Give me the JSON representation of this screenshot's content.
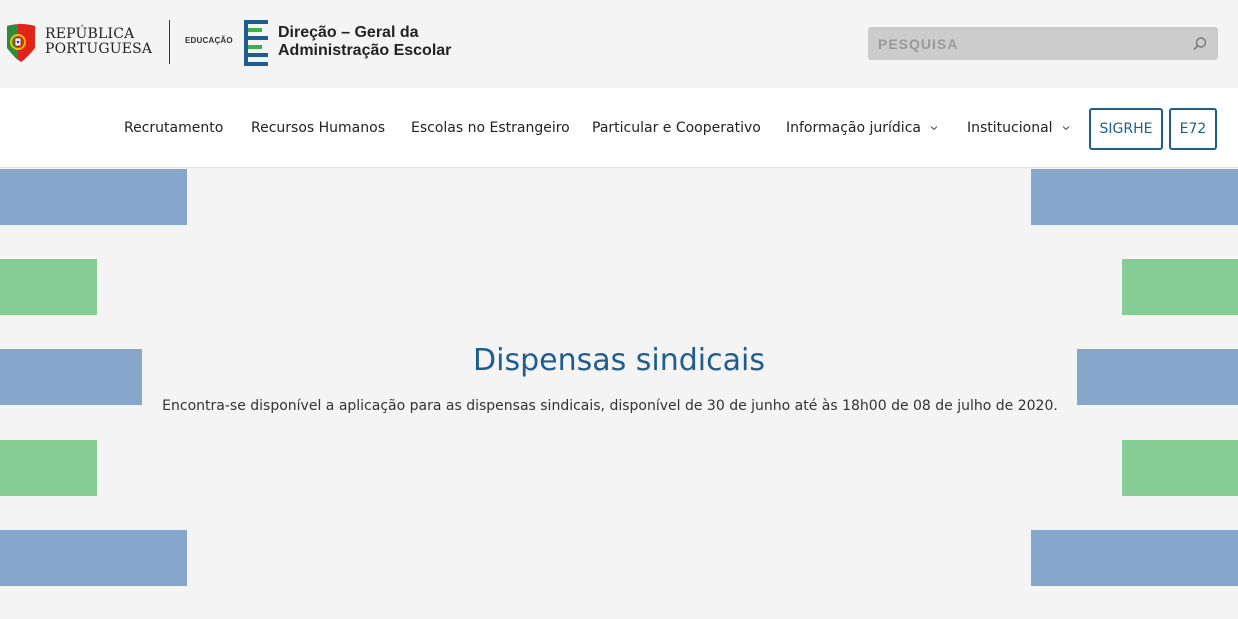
{
  "header": {
    "republica_line1": "REPÚBLICA",
    "republica_line2": "PORTUGUESA",
    "educacao": "EDUCAÇÃO",
    "dg_line1": "Direção – Geral da",
    "dg_line2": "Administração Escolar",
    "search_placeholder": "PESQUISA"
  },
  "nav": {
    "items": [
      {
        "label": "Recrutamento"
      },
      {
        "label": "Recursos Humanos"
      },
      {
        "label": "Escolas no Estrangeiro"
      },
      {
        "label": "Particular e Cooperativo"
      },
      {
        "label": "Informação jurídica",
        "dropdown": true
      },
      {
        "label": "Institucional",
        "dropdown": true
      }
    ],
    "buttons": [
      {
        "label": "SIGRHE"
      },
      {
        "label": "E72"
      }
    ]
  },
  "hero": {
    "title": "Dispensas sindicais",
    "text": "Encontra-se disponível a aplicação para as dispensas sindicais, disponível de 30 de junho até às 18h00 de 08 de julho de 2020."
  },
  "colors": {
    "accent": "#1f5d8f",
    "bar_blue": "#86a6cc",
    "bar_green": "#85cd94",
    "dg_blue": "#1f5d8f",
    "dg_green": "#3eb04b"
  }
}
